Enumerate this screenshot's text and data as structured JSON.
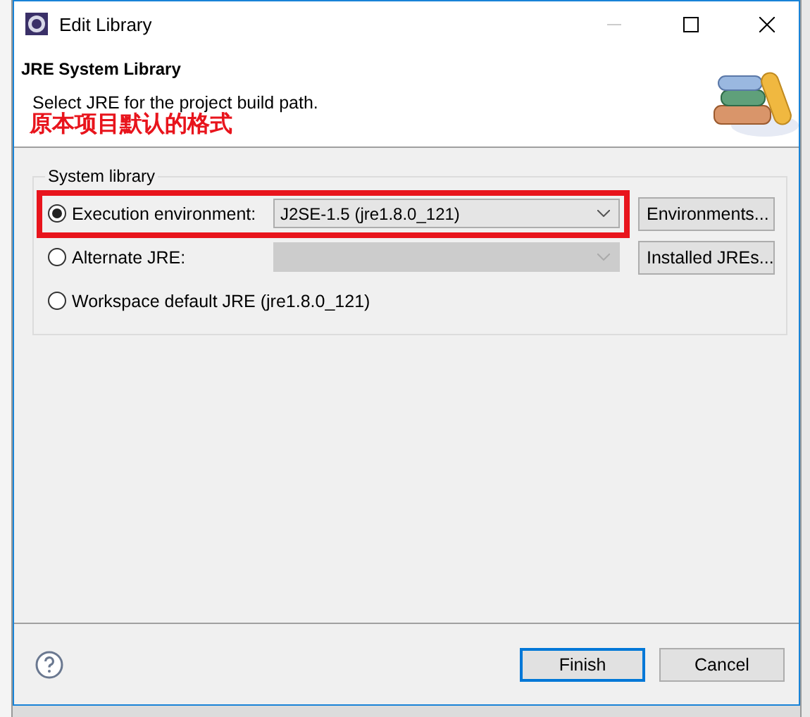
{
  "window": {
    "title": "Edit Library"
  },
  "header": {
    "title": "JRE System Library",
    "description": "Select JRE for the project build path.",
    "annotation": "原本项目默认的格式"
  },
  "group": {
    "label": "System library"
  },
  "options": [
    {
      "label": "Execution environment:",
      "selected": true,
      "highlighted": true,
      "combo": {
        "value": "J2SE-1.5 (jre1.8.0_121)",
        "disabled": false
      },
      "button": "Environments..."
    },
    {
      "label": "Alternate JRE:",
      "selected": false,
      "highlighted": false,
      "combo": {
        "disabled": true
      },
      "button": "Installed JREs..."
    },
    {
      "label": "Workspace default JRE (jre1.8.0_121)",
      "selected": false,
      "highlighted": false
    }
  ],
  "footer": {
    "buttons": [
      {
        "label": "Finish",
        "default": true
      },
      {
        "label": "Cancel",
        "default": false
      }
    ]
  }
}
